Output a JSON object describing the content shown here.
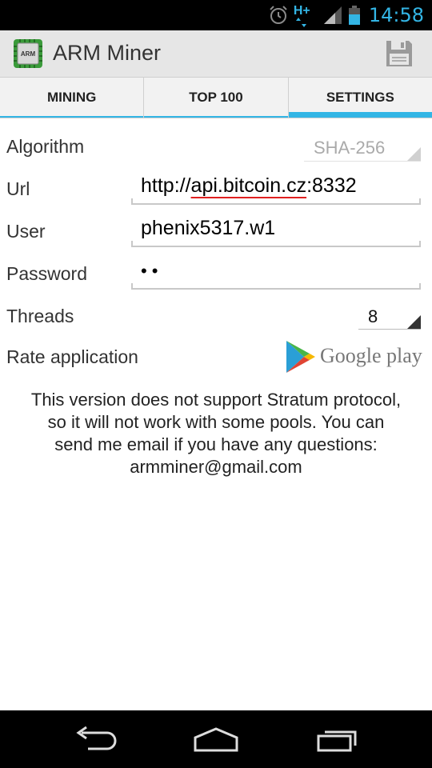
{
  "status": {
    "time": "14:58",
    "network": "H+"
  },
  "app": {
    "title": "ARM Miner",
    "icon_label": "ARM"
  },
  "tabs": [
    {
      "label": "MINING",
      "selected": false
    },
    {
      "label": "TOP 100",
      "selected": false
    },
    {
      "label": "SETTINGS",
      "selected": true
    }
  ],
  "settings": {
    "algorithm": {
      "label": "Algorithm",
      "value": "SHA-256"
    },
    "url": {
      "label": "Url",
      "value_prefix": "http://",
      "value_spell": "api.bitcoin.cz",
      "value_suffix": ":8332"
    },
    "user": {
      "label": "User",
      "value": "phenix5317.w1"
    },
    "password": {
      "label": "Password",
      "value": "••"
    },
    "threads": {
      "label": "Threads",
      "value": "8"
    },
    "rate": {
      "label": "Rate application",
      "store_text": "Google play"
    }
  },
  "info_lines": [
    "This version does not support Stratum protocol,",
    "so it will not work with some pools. You can",
    "send me email if you have any questions:",
    "armminer@gmail.com"
  ],
  "colors": {
    "accent": "#33b5e5",
    "actionbar": "#e6e6e6",
    "icon_green": "#3a9a3a"
  }
}
